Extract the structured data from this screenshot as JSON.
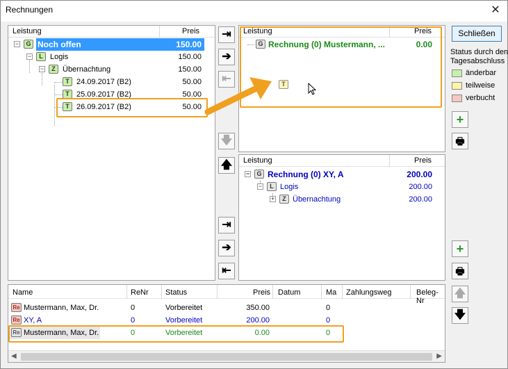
{
  "window": {
    "title": "Rechnungen",
    "close_glyph": "✕"
  },
  "colors": {
    "selection": "#3399ff",
    "highlight": "#f0a020",
    "green_text": "#1a8a1a",
    "blue_text": "#0000c0"
  },
  "left_tree": {
    "headers": {
      "leistung": "Leistung",
      "preis": "Preis"
    },
    "rows": [
      {
        "badge": "G",
        "label": "Noch offen",
        "price": "150.00"
      },
      {
        "badge": "L",
        "label": "Logis",
        "price": "150.00"
      },
      {
        "badge": "Z",
        "label": "Übernachtung",
        "price": "150.00"
      },
      {
        "badge": "T",
        "label": "24.09.2017 (B2)",
        "price": "50.00"
      },
      {
        "badge": "T",
        "label": "25.09.2017 (B2)",
        "price": "50.00"
      },
      {
        "badge": "T",
        "label": "26.09.2017 (B2)",
        "price": "50.00"
      }
    ]
  },
  "invoice_top": {
    "headers": {
      "leistung": "Leistung",
      "preis": "Preis"
    },
    "rows": [
      {
        "badge": "G",
        "label": "Rechnung (0) Mustermann, ...",
        "price": "0.00"
      }
    ],
    "drag_badge": "T"
  },
  "invoice_bottom": {
    "headers": {
      "leistung": "Leistung",
      "preis": "Preis"
    },
    "rows": [
      {
        "badge": "G",
        "label": "Rechnung (0) XY, A",
        "price": "200.00"
      },
      {
        "badge": "L",
        "label": "Logis",
        "price": "200.00"
      },
      {
        "badge": "Z",
        "label": "Übernachtung",
        "price": "200.00"
      }
    ]
  },
  "right_panel": {
    "close_button": "Schließen",
    "legend_title": "Status durch den Tagesabschluss",
    "legend": [
      {
        "label": "änderbar",
        "color": "#c8f0a8"
      },
      {
        "label": "teilweise",
        "color": "#fff3a8"
      },
      {
        "label": "verbucht",
        "color": "#f4c8c0"
      }
    ],
    "add_icon": "+",
    "print_icon": "🖶"
  },
  "table": {
    "headers": [
      "Name",
      "ReNr",
      "Status",
      "Preis",
      "Datum",
      "Ma",
      "Zahlungsweg",
      "Beleg-Nr"
    ],
    "rows": [
      {
        "badge": "Re",
        "name": "Mustermann, Max, Dr.",
        "renr": "0",
        "status": "Vorbereitet",
        "preis": "350.00",
        "ma": "0",
        "color": "#000000"
      },
      {
        "badge": "Re",
        "name": "XY, A",
        "renr": "0",
        "status": "Vorbereitet",
        "preis": "200.00",
        "ma": "0",
        "color": "#0000c0"
      },
      {
        "badge": "Re",
        "name": "Mustermann, Max, Dr.",
        "renr": "0",
        "status": "Vorbereitet",
        "preis": "0.00",
        "ma": "0",
        "color": "#1a8a1a"
      }
    ]
  },
  "arrows": {
    "move_last": "⇥",
    "move_right": "➔",
    "move_first": "⇤",
    "down": "🡇",
    "up": "🡅"
  }
}
